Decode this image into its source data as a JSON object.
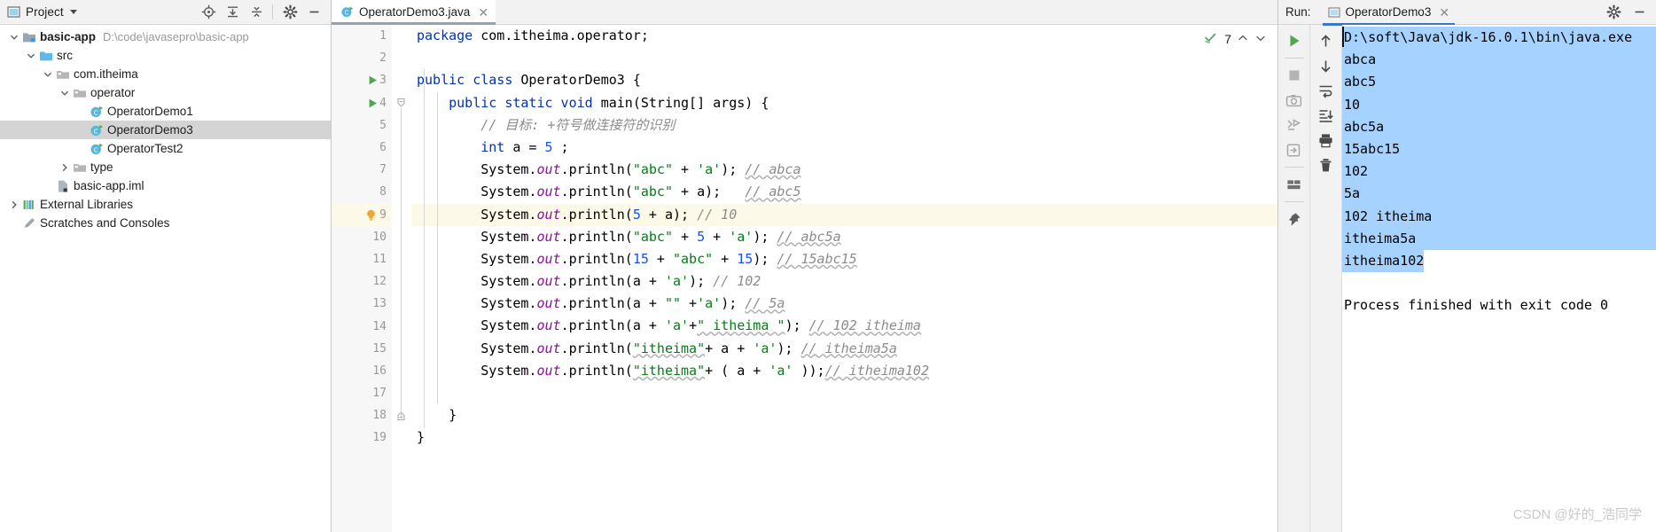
{
  "project_panel": {
    "header": {
      "title": "Project",
      "caret_icon": "chevron-down-icon",
      "panel_icon": "project-icon",
      "tools": [
        {
          "name": "locate-icon",
          "label": "Select Opened File"
        },
        {
          "name": "expand-all-icon",
          "label": "Expand All"
        },
        {
          "name": "collapse-all-icon",
          "label": "Collapse All"
        },
        {
          "name": "gear-icon",
          "label": "Settings"
        },
        {
          "name": "minimize-icon",
          "label": "Hide"
        }
      ]
    },
    "tree": [
      {
        "label": "basic-app",
        "path": "D:\\code\\javasepro\\basic-app",
        "indent": 0,
        "icon": "module-icon",
        "arrow": "expanded",
        "bold": true,
        "selected": false
      },
      {
        "label": "src",
        "path": "",
        "indent": 1,
        "icon": "source-folder-icon",
        "arrow": "expanded",
        "bold": false,
        "selected": false
      },
      {
        "label": "com.itheima",
        "path": "",
        "indent": 2,
        "icon": "package-icon",
        "arrow": "expanded",
        "bold": false,
        "selected": false
      },
      {
        "label": "operator",
        "path": "",
        "indent": 3,
        "icon": "package-icon",
        "arrow": "expanded",
        "bold": false,
        "selected": false
      },
      {
        "label": "OperatorDemo1",
        "path": "",
        "indent": 4,
        "icon": "java-class-icon",
        "arrow": "none",
        "bold": false,
        "selected": false
      },
      {
        "label": "OperatorDemo3",
        "path": "",
        "indent": 4,
        "icon": "java-class-icon",
        "arrow": "none",
        "bold": false,
        "selected": true
      },
      {
        "label": "OperatorTest2",
        "path": "",
        "indent": 4,
        "icon": "java-class-icon",
        "arrow": "none",
        "bold": false,
        "selected": false
      },
      {
        "label": "type",
        "path": "",
        "indent": 3,
        "icon": "package-icon",
        "arrow": "collapsed",
        "bold": false,
        "selected": false
      },
      {
        "label": "basic-app.iml",
        "path": "",
        "indent": 2,
        "icon": "iml-file-icon",
        "arrow": "none",
        "bold": false,
        "selected": false
      },
      {
        "label": "External Libraries",
        "path": "",
        "indent": 0,
        "icon": "libraries-icon",
        "arrow": "collapsed",
        "bold": false,
        "selected": false
      },
      {
        "label": "Scratches and Consoles",
        "path": "",
        "indent": 0,
        "icon": "scratches-icon",
        "arrow": "none",
        "bold": false,
        "selected": false
      }
    ]
  },
  "editor": {
    "tab": {
      "label": "OperatorDemo3.java",
      "icon": "java-class-icon",
      "close_icon": "close-icon",
      "active": true
    },
    "inspection": {
      "icon": "inspection-ok-icon",
      "count": "7",
      "up_icon": "chevron-up-icon",
      "down_icon": "chevron-down-icon"
    },
    "caret_line": 9,
    "lines": [
      {
        "n": 1,
        "gutter_icon": "none",
        "tokens": [
          {
            "t": "package ",
            "c": "kw"
          },
          {
            "t": "com.itheima.operator;",
            "c": ""
          }
        ]
      },
      {
        "n": 2,
        "gutter_icon": "none",
        "tokens": []
      },
      {
        "n": 3,
        "gutter_icon": "run-icon",
        "tokens": [
          {
            "t": "public class ",
            "c": "kw"
          },
          {
            "t": "OperatorDemo3 {",
            "c": ""
          }
        ]
      },
      {
        "n": 4,
        "gutter_icon": "run-icon",
        "tokens": [
          {
            "t": "    ",
            "c": ""
          },
          {
            "t": "public static void ",
            "c": "kw"
          },
          {
            "t": "main(String[] args) {",
            "c": ""
          }
        ]
      },
      {
        "n": 5,
        "gutter_icon": "none",
        "tokens": [
          {
            "t": "        ",
            "c": ""
          },
          {
            "t": "// 目标: +符号做连接符的识别",
            "c": "cmt"
          }
        ]
      },
      {
        "n": 6,
        "gutter_icon": "none",
        "tokens": [
          {
            "t": "        ",
            "c": ""
          },
          {
            "t": "int ",
            "c": "kw"
          },
          {
            "t": "a = ",
            "c": ""
          },
          {
            "t": "5",
            "c": "num"
          },
          {
            "t": " ;",
            "c": ""
          }
        ]
      },
      {
        "n": 7,
        "gutter_icon": "none",
        "tokens": [
          {
            "t": "        System.",
            "c": ""
          },
          {
            "t": "out",
            "c": "fld"
          },
          {
            "t": ".println(",
            "c": ""
          },
          {
            "t": "\"abc\"",
            "c": "str"
          },
          {
            "t": " + ",
            "c": ""
          },
          {
            "t": "'a'",
            "c": "str"
          },
          {
            "t": "); ",
            "c": ""
          },
          {
            "t": "// abca",
            "c": "cmt spell"
          }
        ]
      },
      {
        "n": 8,
        "gutter_icon": "none",
        "tokens": [
          {
            "t": "        System.",
            "c": ""
          },
          {
            "t": "out",
            "c": "fld"
          },
          {
            "t": ".println(",
            "c": ""
          },
          {
            "t": "\"abc\"",
            "c": "str"
          },
          {
            "t": " + a);   ",
            "c": ""
          },
          {
            "t": "// abc5",
            "c": "cmt spell"
          }
        ]
      },
      {
        "n": 9,
        "gutter_icon": "bulb-icon",
        "tokens": [
          {
            "t": "        System.",
            "c": ""
          },
          {
            "t": "out",
            "c": "fld"
          },
          {
            "t": ".println(",
            "c": ""
          },
          {
            "t": "5",
            "c": "num"
          },
          {
            "t": " + a); ",
            "c": ""
          },
          {
            "t": "// 10",
            "c": "cmt"
          }
        ]
      },
      {
        "n": 10,
        "gutter_icon": "none",
        "tokens": [
          {
            "t": "        System.",
            "c": ""
          },
          {
            "t": "out",
            "c": "fld"
          },
          {
            "t": ".println(",
            "c": ""
          },
          {
            "t": "\"abc\"",
            "c": "str"
          },
          {
            "t": " + ",
            "c": ""
          },
          {
            "t": "5",
            "c": "num"
          },
          {
            "t": " + ",
            "c": ""
          },
          {
            "t": "'a'",
            "c": "str"
          },
          {
            "t": "); ",
            "c": ""
          },
          {
            "t": "// abc5a",
            "c": "cmt spell"
          }
        ]
      },
      {
        "n": 11,
        "gutter_icon": "none",
        "tokens": [
          {
            "t": "        System.",
            "c": ""
          },
          {
            "t": "out",
            "c": "fld"
          },
          {
            "t": ".println(",
            "c": ""
          },
          {
            "t": "15",
            "c": "num"
          },
          {
            "t": " + ",
            "c": ""
          },
          {
            "t": "\"abc\"",
            "c": "str"
          },
          {
            "t": " + ",
            "c": ""
          },
          {
            "t": "15",
            "c": "num"
          },
          {
            "t": "); ",
            "c": ""
          },
          {
            "t": "// 15abc15",
            "c": "cmt spell"
          }
        ]
      },
      {
        "n": 12,
        "gutter_icon": "none",
        "tokens": [
          {
            "t": "        System.",
            "c": ""
          },
          {
            "t": "out",
            "c": "fld"
          },
          {
            "t": ".println(a + ",
            "c": ""
          },
          {
            "t": "'a'",
            "c": "str"
          },
          {
            "t": "); ",
            "c": ""
          },
          {
            "t": "// 102",
            "c": "cmt"
          }
        ]
      },
      {
        "n": 13,
        "gutter_icon": "none",
        "tokens": [
          {
            "t": "        System.",
            "c": ""
          },
          {
            "t": "out",
            "c": "fld"
          },
          {
            "t": ".println(a + ",
            "c": ""
          },
          {
            "t": "\"\"",
            "c": "str"
          },
          {
            "t": " +",
            "c": ""
          },
          {
            "t": "'a'",
            "c": "str"
          },
          {
            "t": "); ",
            "c": ""
          },
          {
            "t": "// 5a",
            "c": "cmt spell"
          }
        ]
      },
      {
        "n": 14,
        "gutter_icon": "none",
        "tokens": [
          {
            "t": "        System.",
            "c": ""
          },
          {
            "t": "out",
            "c": "fld"
          },
          {
            "t": ".println(a + ",
            "c": ""
          },
          {
            "t": "'a'",
            "c": "str"
          },
          {
            "t": "+",
            "c": ""
          },
          {
            "t": "\" itheima \"",
            "c": "str spell"
          },
          {
            "t": "); ",
            "c": ""
          },
          {
            "t": "// 102 itheima",
            "c": "cmt spell"
          }
        ]
      },
      {
        "n": 15,
        "gutter_icon": "none",
        "tokens": [
          {
            "t": "        System.",
            "c": ""
          },
          {
            "t": "out",
            "c": "fld"
          },
          {
            "t": ".println(",
            "c": ""
          },
          {
            "t": "\"itheima\"",
            "c": "str spell"
          },
          {
            "t": "+ a + ",
            "c": ""
          },
          {
            "t": "'a'",
            "c": "str"
          },
          {
            "t": "); ",
            "c": ""
          },
          {
            "t": "// itheima5a",
            "c": "cmt spell"
          }
        ]
      },
      {
        "n": 16,
        "gutter_icon": "none",
        "tokens": [
          {
            "t": "        System.",
            "c": ""
          },
          {
            "t": "out",
            "c": "fld"
          },
          {
            "t": ".println(",
            "c": ""
          },
          {
            "t": "\"itheima\"",
            "c": "str spell"
          },
          {
            "t": "+ ( a + ",
            "c": ""
          },
          {
            "t": "'a'",
            "c": "str"
          },
          {
            "t": " ));",
            "c": ""
          },
          {
            "t": "// itheima102",
            "c": "cmt spell"
          }
        ]
      },
      {
        "n": 17,
        "gutter_icon": "none",
        "tokens": []
      },
      {
        "n": 18,
        "gutter_icon": "none",
        "tokens": [
          {
            "t": "    }",
            "c": ""
          }
        ]
      },
      {
        "n": 19,
        "gutter_icon": "none",
        "tokens": [
          {
            "t": "}",
            "c": ""
          }
        ]
      }
    ]
  },
  "run_panel": {
    "label": "Run:",
    "tab": {
      "label": "OperatorDemo3",
      "icon": "run-config-icon",
      "close_icon": "close-icon",
      "active": true
    },
    "header_right": [
      {
        "name": "gear-icon",
        "label": "Settings"
      },
      {
        "name": "minimize-icon",
        "label": "Hide"
      }
    ],
    "toolbar_left": [
      {
        "name": "rerun-icon",
        "label": "Rerun"
      },
      {
        "name": "stop-icon",
        "label": "Stop"
      },
      {
        "name": "screenshot-icon",
        "label": "Dump Threads"
      },
      {
        "name": "restore-layout-icon",
        "label": "Restore Layout"
      },
      {
        "name": "export-icon",
        "label": "Export"
      },
      {
        "name": "layout-icon",
        "label": "Layout Settings"
      },
      {
        "name": "pin-icon",
        "label": "Pin Tab"
      }
    ],
    "toolbar_right": [
      {
        "name": "arrow-up-icon",
        "label": "Up the Stack Trace"
      },
      {
        "name": "arrow-down-icon",
        "label": "Down the Stack Trace"
      },
      {
        "name": "soft-wrap-icon",
        "label": "Use Soft Wraps"
      },
      {
        "name": "scroll-to-end-icon",
        "label": "Scroll to End"
      },
      {
        "name": "print-icon",
        "label": "Print"
      },
      {
        "name": "trash-icon",
        "label": "Clear All"
      }
    ],
    "console_lines": [
      {
        "text": "D:\\soft\\Java\\jdk-16.0.1\\bin\\java.exe ",
        "selected": true
      },
      {
        "text": "abca",
        "selected": true
      },
      {
        "text": "abc5",
        "selected": true
      },
      {
        "text": "10",
        "selected": true
      },
      {
        "text": "abc5a",
        "selected": true
      },
      {
        "text": "15abc15",
        "selected": true
      },
      {
        "text": "102",
        "selected": true
      },
      {
        "text": "5a",
        "selected": true
      },
      {
        "text": "102 itheima",
        "selected": true
      },
      {
        "text": "itheima5a",
        "selected": true
      },
      {
        "text": "itheima102",
        "selected": true
      },
      {
        "text": "",
        "selected": false
      },
      {
        "text": "Process finished with exit code 0",
        "selected": false
      }
    ]
  },
  "watermark": "CSDN @好的_浩同学",
  "colors": {
    "keyword": "#0033b3",
    "string": "#067d17",
    "number": "#1750eb",
    "comment": "#8c8c8c",
    "field": "#871094",
    "selection": "#a6d2ff",
    "caret_row": "#fcf9e8",
    "tree_selection": "#d4d4d4",
    "tab_underline_run": "#3b78c4",
    "tab_underline_editor": "#93a1b5",
    "run_green": "#49a04a",
    "bulb_orange": "#f0a732"
  }
}
